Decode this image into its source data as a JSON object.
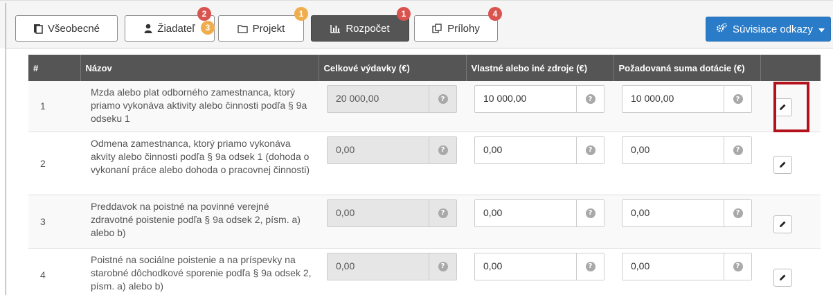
{
  "tabs": [
    {
      "label": "Všeobecné",
      "icon": "document-icon"
    },
    {
      "label": "Žiadateľ",
      "icon": "user-icon"
    },
    {
      "label": "Projekt",
      "icon": "folder-icon"
    },
    {
      "label": "Rozpočet",
      "icon": "bar-chart-icon"
    },
    {
      "label": "Prílohy",
      "icon": "attachments-icon"
    }
  ],
  "badges": {
    "ziadatel_top": "2",
    "ziadatel_bottom": "3",
    "projekt": "1",
    "rozpocet": "1",
    "prilohy": "4"
  },
  "related_button": {
    "label": "Súvisiace odkazy",
    "icon": "cogs-icon"
  },
  "colors": {
    "accent": "#2a7bc8",
    "header": "#555555",
    "badge_red": "#d9534f",
    "badge_orange": "#f0ad4e",
    "highlight": "#b3121d"
  },
  "table": {
    "headers": [
      "#",
      "Názov",
      "Celkové výdavky (€)",
      "Vlastné alebo iné zdroje (€)",
      "Požadovaná suma dotácie (€)",
      ""
    ],
    "rows": [
      {
        "num": "1",
        "name": "Mzda alebo plat odborného zamestnanca, ktorý priamo vykonáva aktivity alebo činnosti podľa § 9a odseku 1",
        "total": "20 000,00",
        "own": "10 000,00",
        "requested": "10 000,00"
      },
      {
        "num": "2",
        "name": "Odmena zamestnanca, ktorý priamo vykonáva akvity alebo činnosti podľa § 9a odsek 1 (dohoda o vykonaní práce alebo dohoda o pracovnej činnosti)",
        "total": "0,00",
        "own": "0,00",
        "requested": "0,00"
      },
      {
        "num": "3",
        "name": "Preddavok na poistné na povinné verejné zdravotné poistenie podľa § 9a odsek 2, písm. a) alebo b)",
        "total": "0,00",
        "own": "0,00",
        "requested": "0,00"
      },
      {
        "num": "4",
        "name": "Poistné na sociálne poistenie a na príspevky na starobné dôchodkové sporenie podľa § 9a odsek 2, písm. a) alebo b)",
        "total": "0,00",
        "own": "0,00",
        "requested": "0,00"
      }
    ]
  }
}
